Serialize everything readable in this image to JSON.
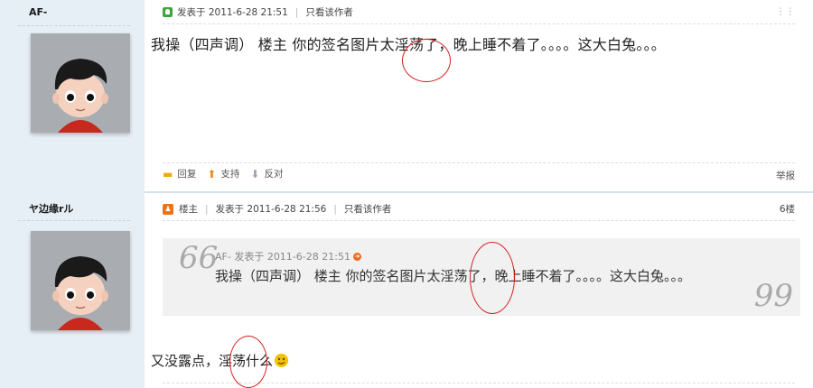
{
  "posts": [
    {
      "username": "AF-",
      "meta": {
        "posted": "发表于 2011-6-28 21:51",
        "only_author": "只看该作者"
      },
      "content": "我操（四声调）  楼主 你的签名图片太淫荡了，晚上睡不着了。。。。这大白兔。。。",
      "actions": {
        "reply": "回复",
        "support": "支持",
        "oppose": "反对",
        "report": "举报"
      }
    },
    {
      "username": "ヤ边缘rル",
      "meta": {
        "host": "楼主",
        "posted": "发表于 2011-6-28 21:56",
        "only_author": "只看该作者",
        "floor": "6楼"
      },
      "quote": {
        "author_line": "AF- 发表于 2011-6-28 21:51",
        "text": "我操（四声调）  楼主 你的签名图片太淫荡了，晚上睡不着了。。。。这大白兔。。。"
      },
      "reply": "又没露点，淫荡什么"
    }
  ],
  "icons": {
    "online": "online-status-icon",
    "host": "thread-starter-icon",
    "reply": "speech-bubble-icon",
    "support": "up-arrow-icon",
    "oppose": "down-arrow-icon",
    "quote_jump": "jump-to-post-icon",
    "emoji": "smiley-icon"
  },
  "colors": {
    "sidebar": "#e6eef6",
    "annotation": "#d42020",
    "support": "#f08a1c",
    "oppose": "#9aa6b2"
  }
}
